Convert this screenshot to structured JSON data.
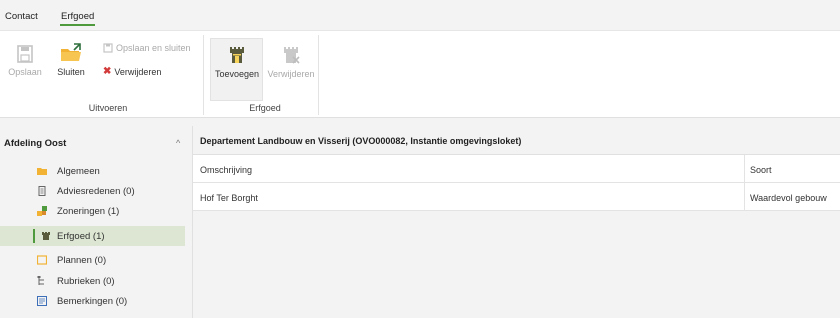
{
  "tabs": [
    {
      "label": "Contact",
      "active": false
    },
    {
      "label": "Erfgoed",
      "active": true
    }
  ],
  "ribbon": {
    "uitvoeren": {
      "label": "Uitvoeren",
      "opslaan": "Opslaan",
      "sluiten": "Sluiten",
      "opslaan_en_sluiten": "Opslaan en sluiten",
      "verwijderen": "Verwijderen"
    },
    "erfgoed": {
      "label": "Erfgoed",
      "toevoegen": "Toevoegen",
      "verwijderen": "Verwijderen"
    }
  },
  "sidebar": {
    "title": "Afdeling Oost",
    "items": [
      {
        "label": "Algemeen",
        "icon": "folder-icon",
        "active": false
      },
      {
        "label": "Adviesredenen (0)",
        "icon": "document-icon",
        "active": false
      },
      {
        "label": "Zoneringen (1)",
        "icon": "zoning-icon",
        "active": false
      },
      {
        "label": "Erfgoed (1)",
        "icon": "castle-icon",
        "active": true
      },
      {
        "label": "Plannen (0)",
        "icon": "plan-icon",
        "active": false
      },
      {
        "label": "Rubrieken (0)",
        "icon": "hierarchy-icon",
        "active": false
      },
      {
        "label": "Bemerkingen (0)",
        "icon": "notes-icon",
        "active": false
      }
    ]
  },
  "main": {
    "title": "Departement Landbouw en Visserij (OVO000082, Instantie omgevingsloket)",
    "columns": [
      "Omschrijving",
      "Soort"
    ],
    "rows": [
      [
        "Hof Ter Borght",
        "Waardevol gebouw"
      ]
    ]
  },
  "colors": {
    "accent": "#4f9a3c",
    "active_bg": "#dde6d2",
    "delete_red": "#d33b3b",
    "folder": "#f2b233"
  }
}
